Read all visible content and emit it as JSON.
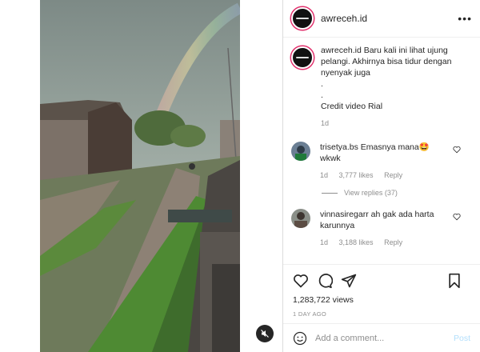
{
  "post": {
    "username": "awreceh.id",
    "more_icon": "more-horizontal-icon"
  },
  "caption": {
    "username": "awreceh.id",
    "text": "Baru kali ini lihat ujung pelangi. Akhirnya bisa tidur dengan nyenyak juga",
    "dot1": ".",
    "dot2": ".",
    "credit": "Credit video Rial",
    "time": "1d"
  },
  "comments": [
    {
      "username": "trisetya.bs",
      "text": "Emasnya mana🤩 wkwk",
      "time": "1d",
      "likes": "3,777 likes",
      "reply": "Reply",
      "view_replies": "View replies (37)"
    },
    {
      "username": "vinnasiregarr",
      "text": "ah gak ada harta karunnya",
      "time": "1d",
      "likes": "3,188 likes",
      "reply": "Reply"
    }
  ],
  "stats": {
    "views": "1,283,722 views",
    "ago": "1 DAY AGO"
  },
  "add_comment": {
    "placeholder": "Add a comment...",
    "post_label": "Post"
  },
  "colors": {
    "accent_disabled": "#b2dffc",
    "muted": "#8e8e8e",
    "text": "#262626"
  }
}
